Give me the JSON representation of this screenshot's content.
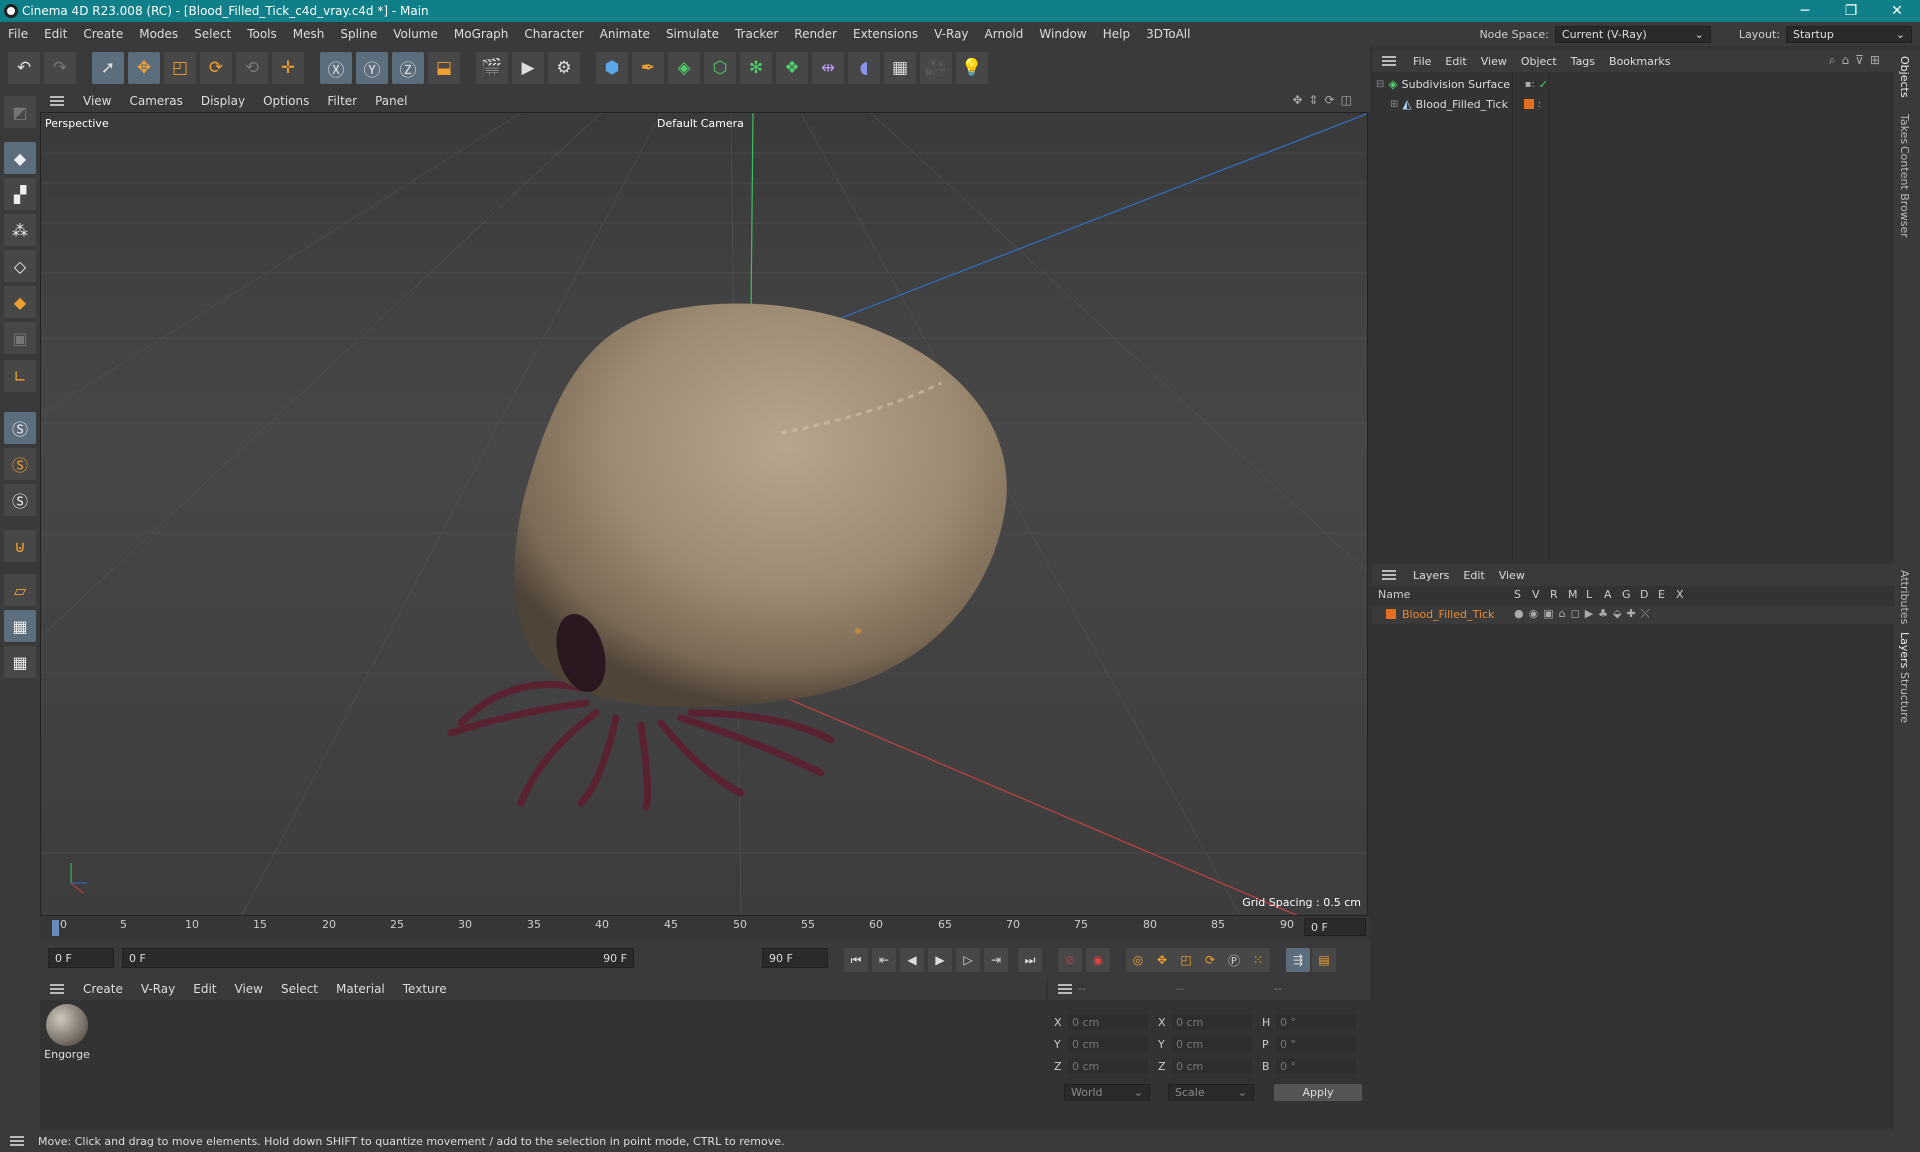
{
  "window": {
    "title": "Cinema 4D R23.008 (RC) - [Blood_Filled_Tick_c4d_vray.c4d *] - Main",
    "min": "─",
    "restore": "❐",
    "close": "✕"
  },
  "menu": [
    "File",
    "Edit",
    "Create",
    "Modes",
    "Select",
    "Tools",
    "Mesh",
    "Spline",
    "Volume",
    "MoGraph",
    "Character",
    "Animate",
    "Simulate",
    "Tracker",
    "Render",
    "Extensions",
    "V-Ray",
    "Arnold",
    "Window",
    "Help",
    "3DToAll"
  ],
  "nodespace": {
    "label": "Node Space:",
    "value": "Current (V-Ray)",
    "layout_label": "Layout:",
    "layout_value": "Startup"
  },
  "viewport": {
    "menu": [
      "View",
      "Cameras",
      "Display",
      "Options",
      "Filter",
      "Panel"
    ],
    "name": "Perspective",
    "camera": "Default Camera",
    "grid_spacing": "Grid Spacing : 0.5 cm"
  },
  "timeline": {
    "ticks": [
      "0",
      "5",
      "10",
      "15",
      "20",
      "25",
      "30",
      "35",
      "40",
      "45",
      "50",
      "55",
      "60",
      "65",
      "70",
      "75",
      "80",
      "85",
      "90"
    ],
    "current": "0 F"
  },
  "transport": {
    "start": "0 F",
    "range_start": "0 F",
    "range_end": "90 F",
    "end": "90 F"
  },
  "material": {
    "menu": [
      "Create",
      "V-Ray",
      "Edit",
      "View",
      "Select",
      "Material",
      "Texture"
    ],
    "items": [
      {
        "name": "Engorge"
      }
    ]
  },
  "coords": {
    "headers": [
      "--",
      "--",
      "--"
    ],
    "rows": [
      {
        "a": "X",
        "av": "0 cm",
        "b": "X",
        "bv": "0 cm",
        "c": "H",
        "cv": "0 °"
      },
      {
        "a": "Y",
        "av": "0 cm",
        "b": "Y",
        "bv": "0 cm",
        "c": "P",
        "cv": "0 °"
      },
      {
        "a": "Z",
        "av": "0 cm",
        "b": "Z",
        "bv": "0 cm",
        "c": "B",
        "cv": "0 °"
      }
    ],
    "space": "World",
    "mode": "Scale",
    "apply": "Apply"
  },
  "objects": {
    "menu": [
      "File",
      "Edit",
      "View",
      "Object",
      "Tags",
      "Bookmarks"
    ],
    "items": [
      {
        "name": "Subdivision Surface"
      },
      {
        "name": "Blood_Filled_Tick"
      }
    ]
  },
  "layers": {
    "menu": [
      "Layers",
      "Edit",
      "View"
    ],
    "columns": [
      "Name",
      "S",
      "V",
      "R",
      "M",
      "L",
      "A",
      "G",
      "D",
      "E",
      "X"
    ],
    "items": [
      {
        "name": "Blood_Filled_Tick",
        "color": "#e07020"
      }
    ]
  },
  "sidetabs": [
    "Objects",
    "Takes",
    "Content Browser",
    "Attributes",
    "Layers",
    "Structure"
  ],
  "status": "Move: Click and drag to move elements. Hold down SHIFT to quantize movement / add to the selection in point mode, CTRL to remove."
}
